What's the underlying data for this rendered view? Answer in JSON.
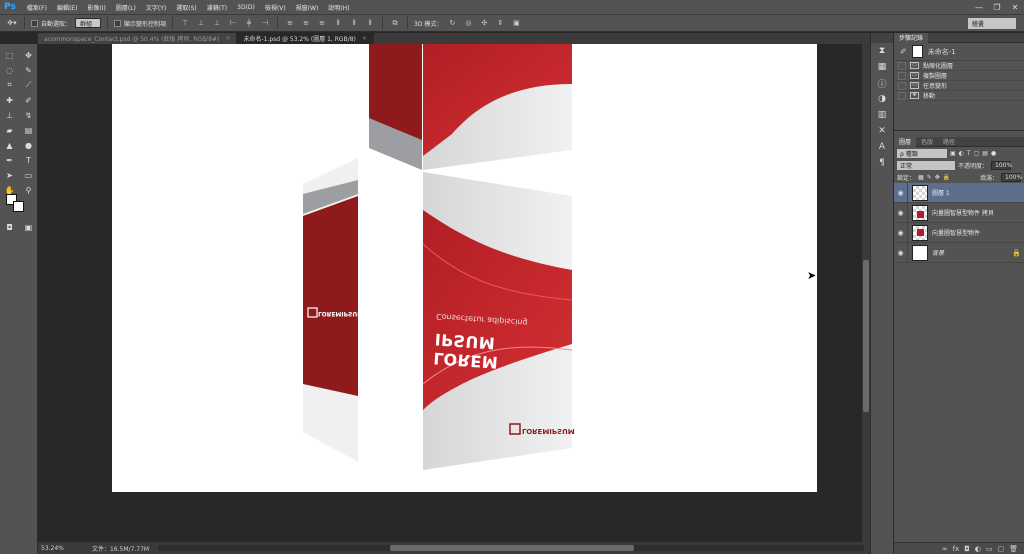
{
  "app": {
    "logo": "Ps"
  },
  "menu": [
    "檔案(F)",
    "編輯(E)",
    "影像(I)",
    "圖層(L)",
    "文字(Y)",
    "選取(S)",
    "濾鏡(T)",
    "3D(D)",
    "檢視(V)",
    "視窗(W)",
    "說明(H)"
  ],
  "window_controls": {
    "minimize": "—",
    "maximize": "❐",
    "close": "✕"
  },
  "options": {
    "auto_select_label": "自動選取：",
    "auto_select_value": "群組",
    "transform_label": "顯示變形控制項",
    "mode_3d_label": "3D 模式：",
    "workspace": "繪畫"
  },
  "tabs": [
    {
      "label": "acommonspace_Contact.psd @ 50.4% (底板 拷貝, RGB/8#)",
      "close": "×"
    },
    {
      "label": "未命名-1.psd @ 53.2% (圖層 1, RGB/8)",
      "close": "×"
    }
  ],
  "status": {
    "zoom": "53.24%",
    "doc": "文件：16.5M/7.77M"
  },
  "history": {
    "tabs": [
      "步驟記錄"
    ],
    "snapshot": "未命名-1",
    "items": [
      "點陣化圖層",
      "複製圖層",
      "任意變形",
      "移動"
    ]
  },
  "layers": {
    "tabs": [
      "圖層",
      "色版",
      "路徑"
    ],
    "filter": "ρ 種類",
    "blend": "正常",
    "opacity_label": "不透明度：",
    "opacity": "100%",
    "lock_label": "鎖定：",
    "fill_label": "填滿：",
    "fill": "100%",
    "items": [
      {
        "name": "圖層 1",
        "selected": true
      },
      {
        "name": "向量圖智慧型物件 拷貝",
        "selected": false
      },
      {
        "name": "向量圖智慧型物件",
        "selected": false
      },
      {
        "name": "背景",
        "selected": false,
        "locked": true
      }
    ]
  },
  "artwork": {
    "title": "LOREM IPSUM",
    "subtitle": "Consectetur adipiscing",
    "brand": "LOREMIPSUM",
    "brand_small": "LOREMIPSUM"
  },
  "colors": {
    "accent_red": "#c8262b",
    "dark_red": "#8e1a1c",
    "layer_selected": "#5d6f8c"
  }
}
